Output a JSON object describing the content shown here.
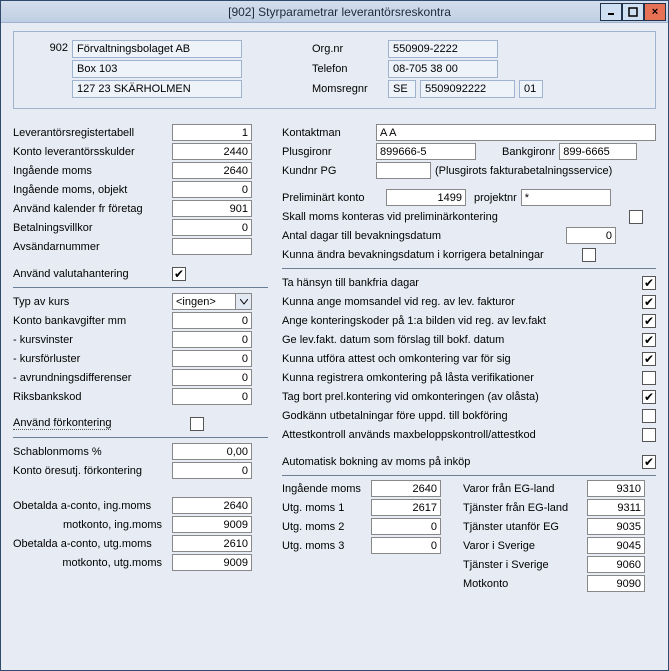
{
  "window": {
    "title": "[902]  Styrparametrar leverantörsreskontra",
    "minimize_glyph": "–",
    "maximize_glyph": "□",
    "close_glyph": "×"
  },
  "header": {
    "company_id": "902",
    "line1": "Förvaltningsbolaget AB",
    "line2": "Box 103",
    "line3": "127 23  SKÄRHOLMEN",
    "orgnr_label": "Org.nr",
    "orgnr": "550909-2222",
    "telefon_label": "Telefon",
    "telefon": "08-705 38 00",
    "momsregnr_label": "Momsregnr",
    "vat_cc": "SE",
    "vat_no": "5509092222",
    "vat_suffix": "01"
  },
  "left": {
    "levregtabell_label": "Leverantörsregistertabell",
    "levregtabell": "1",
    "konto_levskuld_label": "Konto leverantörsskulder",
    "konto_levskuld": "2440",
    "ing_moms_label": "Ingående moms",
    "ing_moms": "2640",
    "ing_moms_obj_label": "Ingående moms, objekt",
    "ing_moms_obj": "0",
    "kal_ftg_label": "Använd kalender fr företag",
    "kal_ftg": "901",
    "bet_villkor_label": "Betalningsvillkor",
    "bet_villkor": "0",
    "avs_nr_label": "Avsändarnummer",
    "avs_nr": "",
    "valuta_label": "Använd valutahantering",
    "valuta_checked": true,
    "typ_kurs_label": "Typ av kurs",
    "typ_kurs": "<ingen>",
    "konto_bankavg_label": "Konto bankavgifter mm",
    "konto_bankavg": "0",
    "kursvinst_label": " - kursvinster",
    "kursvinst": "0",
    "kursforlust_label": " - kursförluster",
    "kursforlust": "0",
    "avrund_label": " - avrundningsdifferenser",
    "avrund": "0",
    "riks_label": "Riksbankskod",
    "riks": "0",
    "forkontering_label": "Använd förkontering",
    "forkontering_checked": false,
    "schablon_label": "Schablonmoms %",
    "schablon": "0,00",
    "oresutj_label": "Konto öresutj. förkontering",
    "oresutj": "0",
    "aconto_ing_label": "Obetalda a-conto, ing.moms",
    "aconto_ing": "2640",
    "motk_ing_label": "motkonto, ing.moms",
    "motk_ing": "9009",
    "aconto_utg_label": "Obetalda a-conto, utg.moms",
    "aconto_utg": "2610",
    "motk_utg_label": "motkonto, utg.moms",
    "motk_utg": "9009"
  },
  "right": {
    "kontaktman_label": "Kontaktman",
    "kontaktman": "A A",
    "plusgironr_label": "Plusgironr",
    "plusgironr": "899666-5",
    "bankgironr_label": "Bankgironr",
    "bankgironr": "899-6665",
    "kundnr_pg_label": "Kundnr PG",
    "kundnr_pg": "",
    "kundnr_pg_hint": "(Plusgirots fakturabetalningsservice)",
    "prel_konto_label": "Preliminärt konto",
    "prel_konto": "1499",
    "proj_label": "projektnr",
    "proj": "*",
    "moms_prel_label": "Skall moms konteras vid preliminärkontering",
    "moms_prel_checked": false,
    "dagar_label": "Antal dagar till bevakningsdatum",
    "dagar": "0",
    "andra_bev_label": "Kunna ändra bevakningsdatum i korrigera betalningar",
    "andra_bev_checked": false,
    "opts": [
      {
        "label": "Ta hänsyn till bankfria dagar",
        "checked": true
      },
      {
        "label": "Kunna ange momsandel vid reg. av lev. fakturor",
        "checked": true
      },
      {
        "label": "Ange konteringskoder på 1:a bilden vid reg. av lev.fakt",
        "checked": true
      },
      {
        "label": "Ge lev.fakt. datum som förslag till bokf. datum",
        "checked": true
      },
      {
        "label": "Kunna utföra attest och omkontering var för sig",
        "checked": true
      },
      {
        "label": "Kunna registrera omkontering på låsta verifikationer",
        "checked": false
      },
      {
        "label": "Tag bort prel.kontering vid omkonteringen (av olåsta)",
        "checked": true
      },
      {
        "label": "Godkänn utbetalningar före uppd. till bokföring",
        "checked": false
      },
      {
        "label": "Attestkontroll används maxbeloppskontroll/attestkod",
        "checked": false
      }
    ],
    "auto_moms_label": "Automatisk bokning av moms på inköp",
    "auto_moms_checked": true,
    "vat_rows": [
      {
        "l1": "Ingående moms",
        "v1": "2640",
        "l2": "Varor från EG-land",
        "v2": "9310"
      },
      {
        "l1": "Utg. moms 1",
        "v1": "2617",
        "l2": "Tjänster från EG-land",
        "v2": "9311"
      },
      {
        "l1": "Utg. moms 2",
        "v1": "0",
        "l2": "Tjänster utanför EG",
        "v2": "9035"
      },
      {
        "l1": "Utg. moms 3",
        "v1": "0",
        "l2": "Varor i Sverige",
        "v2": "9045"
      },
      {
        "l1": "",
        "v1": "",
        "l2": "Tjänster i Sverige",
        "v2": "9060"
      },
      {
        "l1": "",
        "v1": "",
        "l2": "Motkonto",
        "v2": "9090"
      }
    ]
  }
}
